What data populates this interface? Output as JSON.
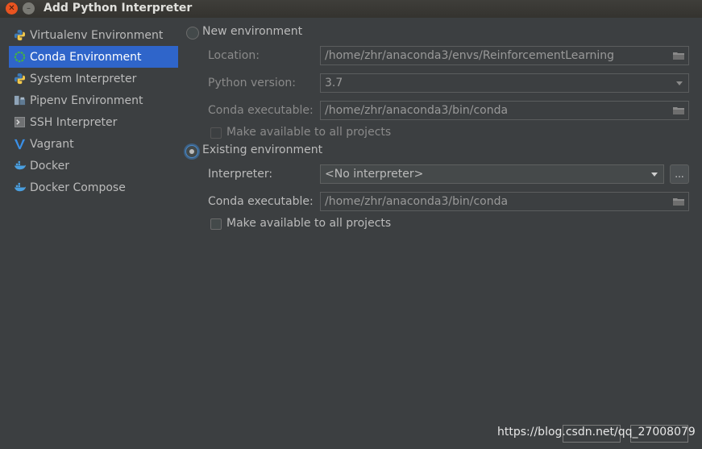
{
  "window": {
    "title": "Add Python Interpreter"
  },
  "sidebar": {
    "items": [
      {
        "label": "Virtualenv Environment",
        "icon": "python-icon"
      },
      {
        "label": "Conda Environment",
        "icon": "conda-icon",
        "selected": true
      },
      {
        "label": "System Interpreter",
        "icon": "python-icon"
      },
      {
        "label": "Pipenv Environment",
        "icon": "pipenv-icon"
      },
      {
        "label": "SSH Interpreter",
        "icon": "terminal-icon"
      },
      {
        "label": "Vagrant",
        "icon": "vagrant-icon"
      },
      {
        "label": "Docker",
        "icon": "docker-icon"
      },
      {
        "label": "Docker Compose",
        "icon": "docker-icon"
      }
    ]
  },
  "new_env": {
    "radio_label": "New environment",
    "location_label": "Location:",
    "location_value": "/home/zhr/anaconda3/envs/ReinforcementLearning",
    "python_version_label": "Python version:",
    "python_version_value": "3.7",
    "conda_exec_label": "Conda executable:",
    "conda_exec_value": "/home/zhr/anaconda3/bin/conda",
    "make_available_label": "Make available to all projects"
  },
  "existing_env": {
    "radio_label": "Existing environment",
    "interpreter_label": "Interpreter:",
    "interpreter_value": "<No interpreter>",
    "more_label": "...",
    "conda_exec_label": "Conda executable:",
    "conda_exec_value": "/home/zhr/anaconda3/bin/conda",
    "make_available_label": "Make available to all projects"
  },
  "watermark": {
    "text": "https://blog.csdn.net/qq_27008079"
  },
  "colors": {
    "background": "#3c3f41",
    "selection": "#2f65ca",
    "close_button": "#e95420"
  }
}
